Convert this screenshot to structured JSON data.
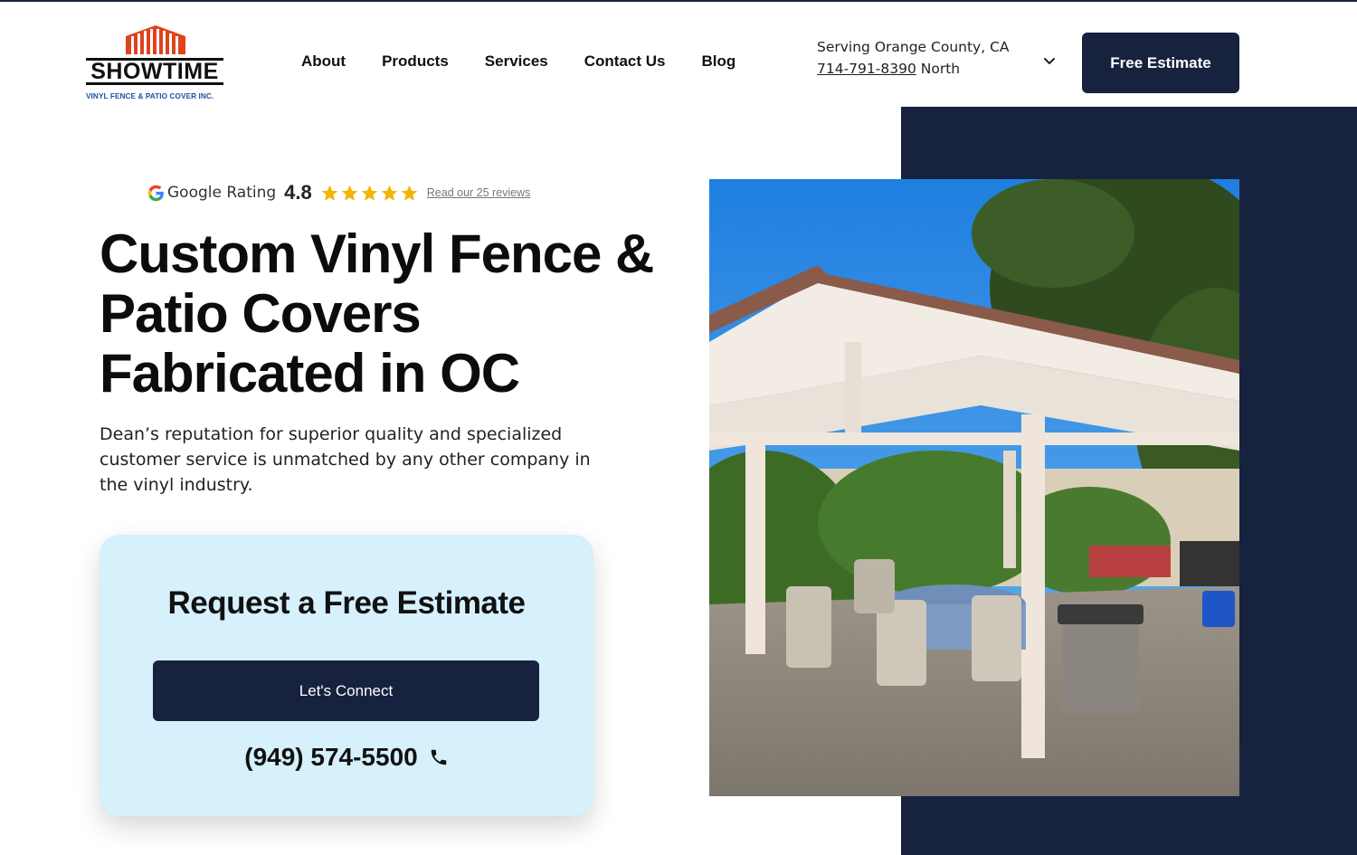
{
  "brand": {
    "name": "SHOWTIME",
    "tagline": "VINYL FENCE & PATIO COVER INC.",
    "logo_color": "#e0431c",
    "tagline_color": "#1f4fa8"
  },
  "nav": {
    "items": [
      {
        "label": "About"
      },
      {
        "label": "Products"
      },
      {
        "label": "Services"
      },
      {
        "label": "Contact Us"
      },
      {
        "label": "Blog"
      }
    ]
  },
  "location": {
    "serving": "Serving Orange County, CA",
    "phone": "714-791-8390",
    "region": "North"
  },
  "header": {
    "cta_label": "Free Estimate"
  },
  "rating": {
    "label": "Google Rating",
    "score": "4.8",
    "stars": 5,
    "reviews_link": "Read our 25 reviews",
    "star_color": "#f5b400"
  },
  "hero": {
    "title": "Custom Vinyl Fence & Patio Covers Fabricated in OC",
    "description": "Dean’s reputation for superior quality and specialized customer service is unmatched by any other company in the vinyl industry."
  },
  "estimate_card": {
    "title": "Request a Free Estimate",
    "button_label": "Let's Connect",
    "phone": "(949) 574-5500"
  },
  "colors": {
    "navy": "#17223f",
    "card_bg": "#d6f0fc"
  }
}
